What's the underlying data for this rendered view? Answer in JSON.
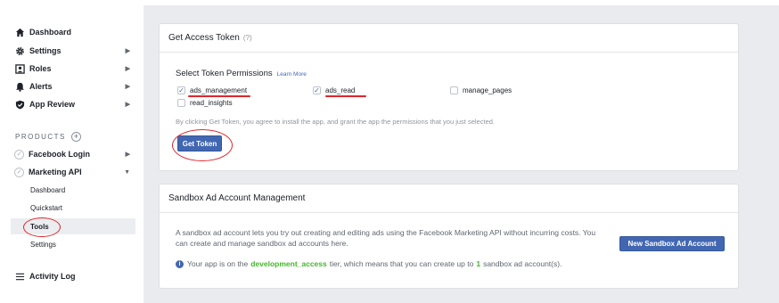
{
  "sidebar": {
    "items": [
      {
        "label": "Dashboard",
        "icon": "house-icon",
        "chevron": false
      },
      {
        "label": "Settings",
        "icon": "gear-icon",
        "chevron": true
      },
      {
        "label": "Roles",
        "icon": "roles-icon",
        "chevron": true
      },
      {
        "label": "Alerts",
        "icon": "bell-icon",
        "chevron": true
      },
      {
        "label": "App Review",
        "icon": "shield-check-icon",
        "chevron": true
      }
    ],
    "products_label": "PRODUCTS",
    "products": [
      {
        "label": "Facebook Login",
        "chevron": "right"
      },
      {
        "label": "Marketing API",
        "chevron": "down"
      }
    ],
    "marketing_sub": [
      "Dashboard",
      "Quickstart",
      "Tools",
      "Settings"
    ],
    "activity_log": "Activity Log"
  },
  "token_card": {
    "title": "Get Access Token",
    "title_suffix": "(?)",
    "permissions_title": "Select Token Permissions",
    "learn_more": "Learn More",
    "permissions": [
      {
        "label": "ads_management",
        "checked": true
      },
      {
        "label": "ads_read",
        "checked": true
      },
      {
        "label": "manage_pages",
        "checked": false
      },
      {
        "label": "read_insights",
        "checked": false
      }
    ],
    "disclaimer": "By clicking Get Token, you agree to install the app, and grant the app the permissions that you just selected.",
    "get_token_label": "Get Token"
  },
  "sandbox_card": {
    "title": "Sandbox Ad Account Management",
    "description": "A sandbox ad account lets you try out creating and editing ads using the Facebook Marketing API without incurring costs. You can create and manage sandbox ad accounts here.",
    "new_button_label": "New Sandbox Ad Account",
    "status_prefix": "Your app is on the",
    "tier": "development_access",
    "status_middle": "tier, which means that you can create up to",
    "count": "1",
    "status_suffix": "sandbox ad account(s)."
  },
  "colors": {
    "accent": "#4267b2",
    "annotation_red": "#e0262c",
    "success_green": "#42b72a",
    "background": "#e9ebee"
  }
}
